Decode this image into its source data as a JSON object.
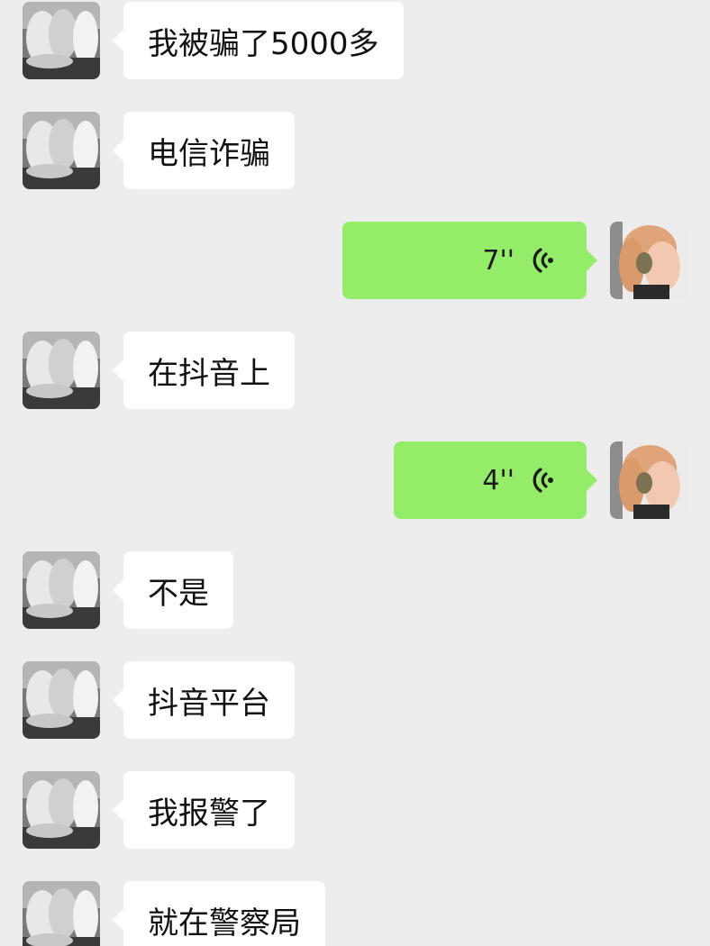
{
  "messages": [
    {
      "side": "in",
      "type": "text",
      "text": "我被骗了5000多"
    },
    {
      "side": "in",
      "type": "text",
      "text": "电信诈骗"
    },
    {
      "side": "out",
      "type": "voice",
      "duration": "7''"
    },
    {
      "side": "in",
      "type": "text",
      "text": "在抖音上"
    },
    {
      "side": "out",
      "type": "voice",
      "duration": "4''"
    },
    {
      "side": "in",
      "type": "text",
      "text": "不是"
    },
    {
      "side": "in",
      "type": "text",
      "text": "抖音平台"
    },
    {
      "side": "in",
      "type": "text",
      "text": "我报警了"
    },
    {
      "side": "in",
      "type": "text",
      "text": "就在警察局"
    }
  ],
  "icons": {
    "contact_avatar": "contact-avatar-photo",
    "self_avatar": "self-avatar-photo",
    "voice": "voice-wave-icon"
  },
  "colors": {
    "background": "#ededed",
    "incoming_bubble": "#ffffff",
    "outgoing_bubble": "#95ec69"
  }
}
